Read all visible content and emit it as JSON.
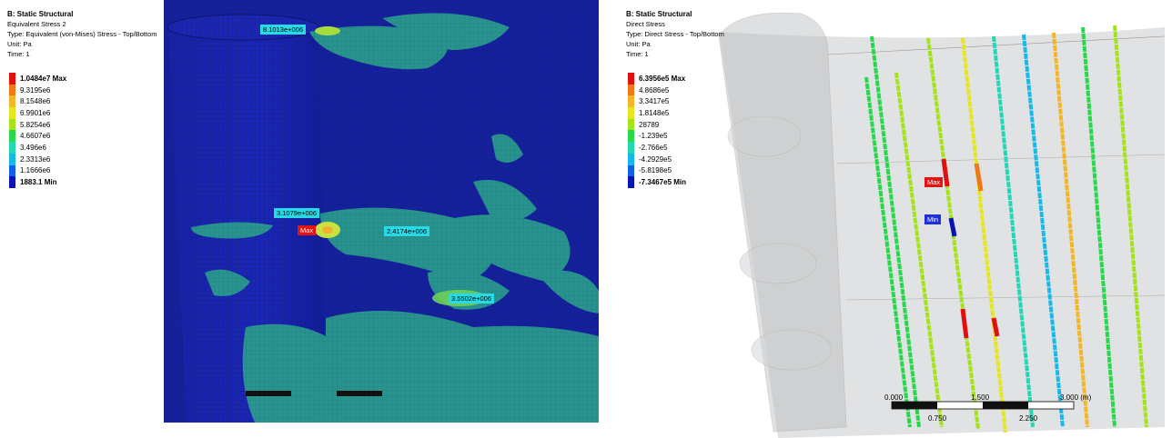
{
  "left_view": {
    "header": {
      "title": "B: Static Structural",
      "result_name": "Equivalent Stress 2",
      "type": "Type: Equivalent (von-Mises) Stress - Top/Bottom",
      "unit": "Unit: Pa",
      "time": "Time: 1"
    },
    "legend": [
      {
        "label": "1.0484e7 Max",
        "color": "#e01010"
      },
      {
        "label": "9.3195e6",
        "color": "#f07818"
      },
      {
        "label": "8.1548e6",
        "color": "#f4b628"
      },
      {
        "label": "6.9901e6",
        "color": "#e6e61e"
      },
      {
        "label": "5.8254e6",
        "color": "#a4e21a"
      },
      {
        "label": "4.6607e6",
        "color": "#26d84a"
      },
      {
        "label": "3.496e6",
        "color": "#22d8b4"
      },
      {
        "label": "2.3313e6",
        "color": "#18b8e8"
      },
      {
        "label": "1.1666e6",
        "color": "#1460e8"
      },
      {
        "label": "1883.1 Min",
        "color": "#0a14b4"
      }
    ],
    "probes": [
      "8.1013e+006",
      "3.1079e+006",
      "Max",
      "2.4174e+006",
      "3.5502e+006"
    ]
  },
  "right_view": {
    "header": {
      "title": "B: Static Structural",
      "result_name": "Direct Stress",
      "type": "Type: Direct Stress - Top/Bottom",
      "unit": "Unit: Pa",
      "time": "Time: 1"
    },
    "legend": [
      {
        "label": "6.3956e5 Max",
        "color": "#e01010"
      },
      {
        "label": "4.8686e5",
        "color": "#f07818"
      },
      {
        "label": "3.3417e5",
        "color": "#f4b628"
      },
      {
        "label": "1.8148e5",
        "color": "#e6e61e"
      },
      {
        "label": "28789",
        "color": "#a4e21a"
      },
      {
        "label": "-1.239e5",
        "color": "#26d84a"
      },
      {
        "label": "-2.766e5",
        "color": "#22d8b4"
      },
      {
        "label": "-4.2929e5",
        "color": "#18b8e8"
      },
      {
        "label": "-5.8198e5",
        "color": "#1460e8"
      },
      {
        "label": "-7.3467e5 Min",
        "color": "#0a14b4"
      }
    ],
    "probes": [
      "Max",
      "Min"
    ],
    "scale_bar": {
      "top_labels": [
        "0.000",
        "1.500",
        "3.000 (m)"
      ],
      "bottom_labels": [
        "0.750",
        "2.250"
      ]
    }
  }
}
